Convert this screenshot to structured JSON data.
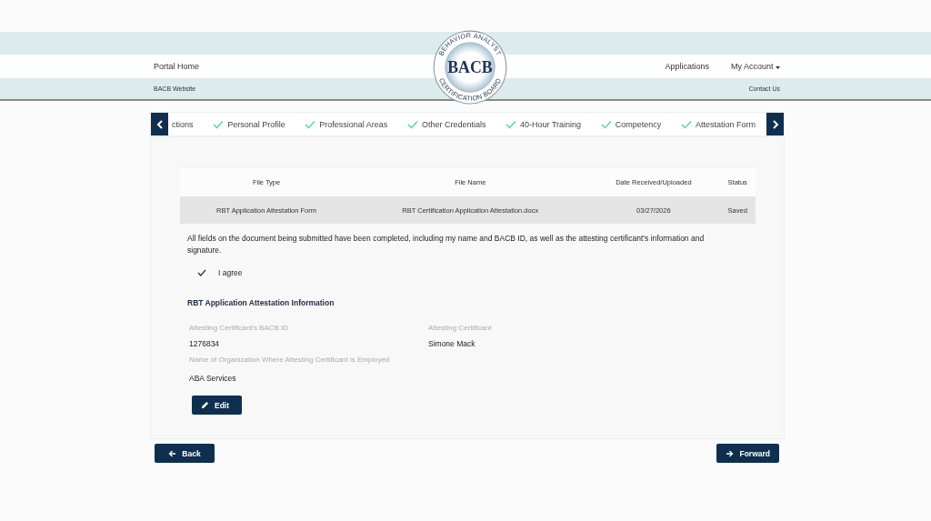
{
  "header": {
    "logo": {
      "top_arc": "BEHAVIOR ANALYST",
      "wordmark": "BACB",
      "bottom_arc": "CERTIFICATION BOARD"
    },
    "nav_left": "Portal Home",
    "nav_right": [
      "Applications",
      "My Account"
    ],
    "sub_left": "BACB Website",
    "sub_right": "Contact Us"
  },
  "steps": [
    {
      "label": "ctions",
      "completed": false
    },
    {
      "label": "Personal Profile",
      "completed": true
    },
    {
      "label": "Professional Areas",
      "completed": true
    },
    {
      "label": "Other Credentials",
      "completed": true
    },
    {
      "label": "40-Hour Training",
      "completed": true
    },
    {
      "label": "Competency",
      "completed": true
    },
    {
      "label": "Attestation Form",
      "completed": true
    }
  ],
  "table": {
    "columns": [
      "File Type",
      "File Name",
      "Date Received/Uploaded",
      "Status"
    ],
    "rows": [
      [
        "RBT Application Attestation Form",
        "RBT Certification Application Attestation.docx",
        "03/27/2026",
        "Saved"
      ]
    ]
  },
  "statement": "All fields on the document being submitted have been completed, including my name and BACB ID, as well as the attesting certificant's information and signature.",
  "agree": {
    "label": "I agree",
    "checked": true
  },
  "section_title": "RBT Application Attestation Information",
  "fields": [
    {
      "label": "Attesting Certificant's BACB ID",
      "value": "1276834"
    },
    {
      "label": "Attesting Certificant",
      "value": "Simone Mack"
    },
    {
      "label": "Name of Organization Where Attesting Certificant is Employed",
      "value": "ABA Services"
    }
  ],
  "edit_button": "Edit",
  "back_button": "Back",
  "forward_button": "Forward"
}
